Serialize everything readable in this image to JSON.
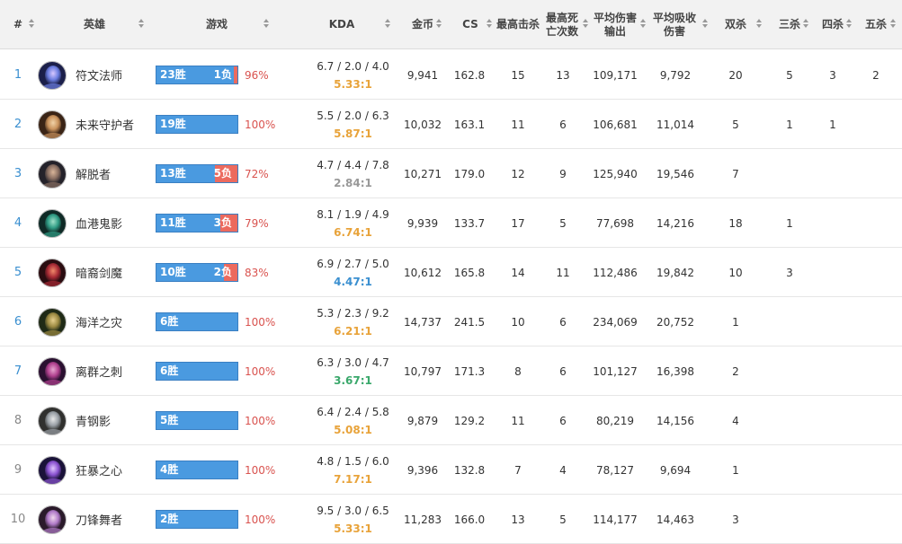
{
  "headers": {
    "rank": "#",
    "hero": "英雄",
    "games": "游戏",
    "kda": "KDA",
    "gold": "金币",
    "cs": "CS",
    "max_kills": "最高击杀",
    "max_deaths_l1": "最高死",
    "max_deaths_l2": "亡次数",
    "avg_dmg_l1": "平均伤害",
    "avg_dmg_l2": "输出",
    "avg_taken_l1": "平均吸收",
    "avg_taken_l2": "伤害",
    "double": "双杀",
    "triple": "三杀",
    "quadra": "四杀",
    "penta": "五杀"
  },
  "colors": {
    "win": "#4a9ae0",
    "loss": "#ec6a5e",
    "pct": "#d9534f",
    "kda_orange": "#e8a33a",
    "kda_gray": "#999999",
    "kda_blue": "#3a8fd0",
    "kda_green": "#3aa86b"
  },
  "rows": [
    {
      "rank": "1",
      "hero": "符文法师",
      "avatar": "rune-mage-avatar",
      "wins": 23,
      "losses": 1,
      "win_label": "23胜",
      "loss_label": "1负",
      "pct": "96%",
      "kda": "6.7 / 2.0 / 4.0",
      "ratio": "5.33:1",
      "ratio_color": "kda_orange",
      "gold": "9,941",
      "cs": "162.8",
      "max_kills": "15",
      "max_deaths": "13",
      "dmg": "109,171",
      "taken": "9,792",
      "double": "20",
      "triple": "5",
      "quadra": "3",
      "penta": "2"
    },
    {
      "rank": "2",
      "hero": "未来守护者",
      "avatar": "future-guardian-avatar",
      "wins": 19,
      "losses": 0,
      "win_label": "19胜",
      "loss_label": "",
      "pct": "100%",
      "kda": "5.5 / 2.0 / 6.3",
      "ratio": "5.87:1",
      "ratio_color": "kda_orange",
      "gold": "10,032",
      "cs": "163.1",
      "max_kills": "11",
      "max_deaths": "6",
      "dmg": "106,681",
      "taken": "11,014",
      "double": "5",
      "triple": "1",
      "quadra": "1",
      "penta": ""
    },
    {
      "rank": "3",
      "hero": "解脱者",
      "avatar": "liberator-avatar",
      "wins": 13,
      "losses": 5,
      "win_label": "13胜",
      "loss_label": "5负",
      "pct": "72%",
      "kda": "4.7 / 4.4 / 7.8",
      "ratio": "2.84:1",
      "ratio_color": "kda_gray",
      "gold": "10,271",
      "cs": "179.0",
      "max_kills": "12",
      "max_deaths": "9",
      "dmg": "125,940",
      "taken": "19,546",
      "double": "7",
      "triple": "",
      "quadra": "",
      "penta": ""
    },
    {
      "rank": "4",
      "hero": "血港鬼影",
      "avatar": "bloodharbor-ghost-avatar",
      "wins": 11,
      "losses": 3,
      "win_label": "11胜",
      "loss_label": "3负",
      "pct": "79%",
      "kda": "8.1 / 1.9 / 4.9",
      "ratio": "6.74:1",
      "ratio_color": "kda_orange",
      "gold": "9,939",
      "cs": "133.7",
      "max_kills": "17",
      "max_deaths": "5",
      "dmg": "77,698",
      "taken": "14,216",
      "double": "18",
      "triple": "1",
      "quadra": "",
      "penta": ""
    },
    {
      "rank": "5",
      "hero": "暗裔剑魔",
      "avatar": "darkin-blade-avatar",
      "wins": 10,
      "losses": 2,
      "win_label": "10胜",
      "loss_label": "2负",
      "pct": "83%",
      "kda": "6.9 / 2.7 / 5.0",
      "ratio": "4.47:1",
      "ratio_color": "kda_blue",
      "gold": "10,612",
      "cs": "165.8",
      "max_kills": "14",
      "max_deaths": "11",
      "dmg": "112,486",
      "taken": "19,842",
      "double": "10",
      "triple": "3",
      "quadra": "",
      "penta": ""
    },
    {
      "rank": "6",
      "hero": "海洋之灾",
      "avatar": "saltwater-scourge-avatar",
      "wins": 6,
      "losses": 0,
      "win_label": "6胜",
      "loss_label": "",
      "pct": "100%",
      "kda": "5.3 / 2.3 / 9.2",
      "ratio": "6.21:1",
      "ratio_color": "kda_orange",
      "gold": "14,737",
      "cs": "241.5",
      "max_kills": "10",
      "max_deaths": "6",
      "dmg": "234,069",
      "taken": "20,752",
      "double": "1",
      "triple": "",
      "quadra": "",
      "penta": ""
    },
    {
      "rank": "7",
      "hero": "离群之刺",
      "avatar": "outcast-thorn-avatar",
      "wins": 6,
      "losses": 0,
      "win_label": "6胜",
      "loss_label": "",
      "pct": "100%",
      "kda": "6.3 / 3.0 / 4.7",
      "ratio": "3.67:1",
      "ratio_color": "kda_green",
      "gold": "10,797",
      "cs": "171.3",
      "max_kills": "8",
      "max_deaths": "6",
      "dmg": "101,127",
      "taken": "16,398",
      "double": "2",
      "triple": "",
      "quadra": "",
      "penta": ""
    },
    {
      "rank": "8",
      "hero": "青钢影",
      "avatar": "steel-shadow-avatar",
      "wins": 5,
      "losses": 0,
      "win_label": "5胜",
      "loss_label": "",
      "pct": "100%",
      "kda": "6.4 / 2.4 / 5.8",
      "ratio": "5.08:1",
      "ratio_color": "kda_orange",
      "gold": "9,879",
      "cs": "129.2",
      "max_kills": "11",
      "max_deaths": "6",
      "dmg": "80,219",
      "taken": "14,156",
      "double": "4",
      "triple": "",
      "quadra": "",
      "penta": ""
    },
    {
      "rank": "9",
      "hero": "狂暴之心",
      "avatar": "heart-of-tempest-avatar",
      "wins": 4,
      "losses": 0,
      "win_label": "4胜",
      "loss_label": "",
      "pct": "100%",
      "kda": "4.8 / 1.5 / 6.0",
      "ratio": "7.17:1",
      "ratio_color": "kda_orange",
      "gold": "9,396",
      "cs": "132.8",
      "max_kills": "7",
      "max_deaths": "4",
      "dmg": "78,127",
      "taken": "9,694",
      "double": "1",
      "triple": "",
      "quadra": "",
      "penta": ""
    },
    {
      "rank": "10",
      "hero": "刀锋舞者",
      "avatar": "blade-dancer-avatar",
      "wins": 2,
      "losses": 0,
      "win_label": "2胜",
      "loss_label": "",
      "pct": "100%",
      "kda": "9.5 / 3.0 / 6.5",
      "ratio": "5.33:1",
      "ratio_color": "kda_orange",
      "gold": "11,283",
      "cs": "166.0",
      "max_kills": "13",
      "max_deaths": "5",
      "dmg": "114,177",
      "taken": "14,463",
      "double": "3",
      "triple": "",
      "quadra": "",
      "penta": ""
    }
  ]
}
